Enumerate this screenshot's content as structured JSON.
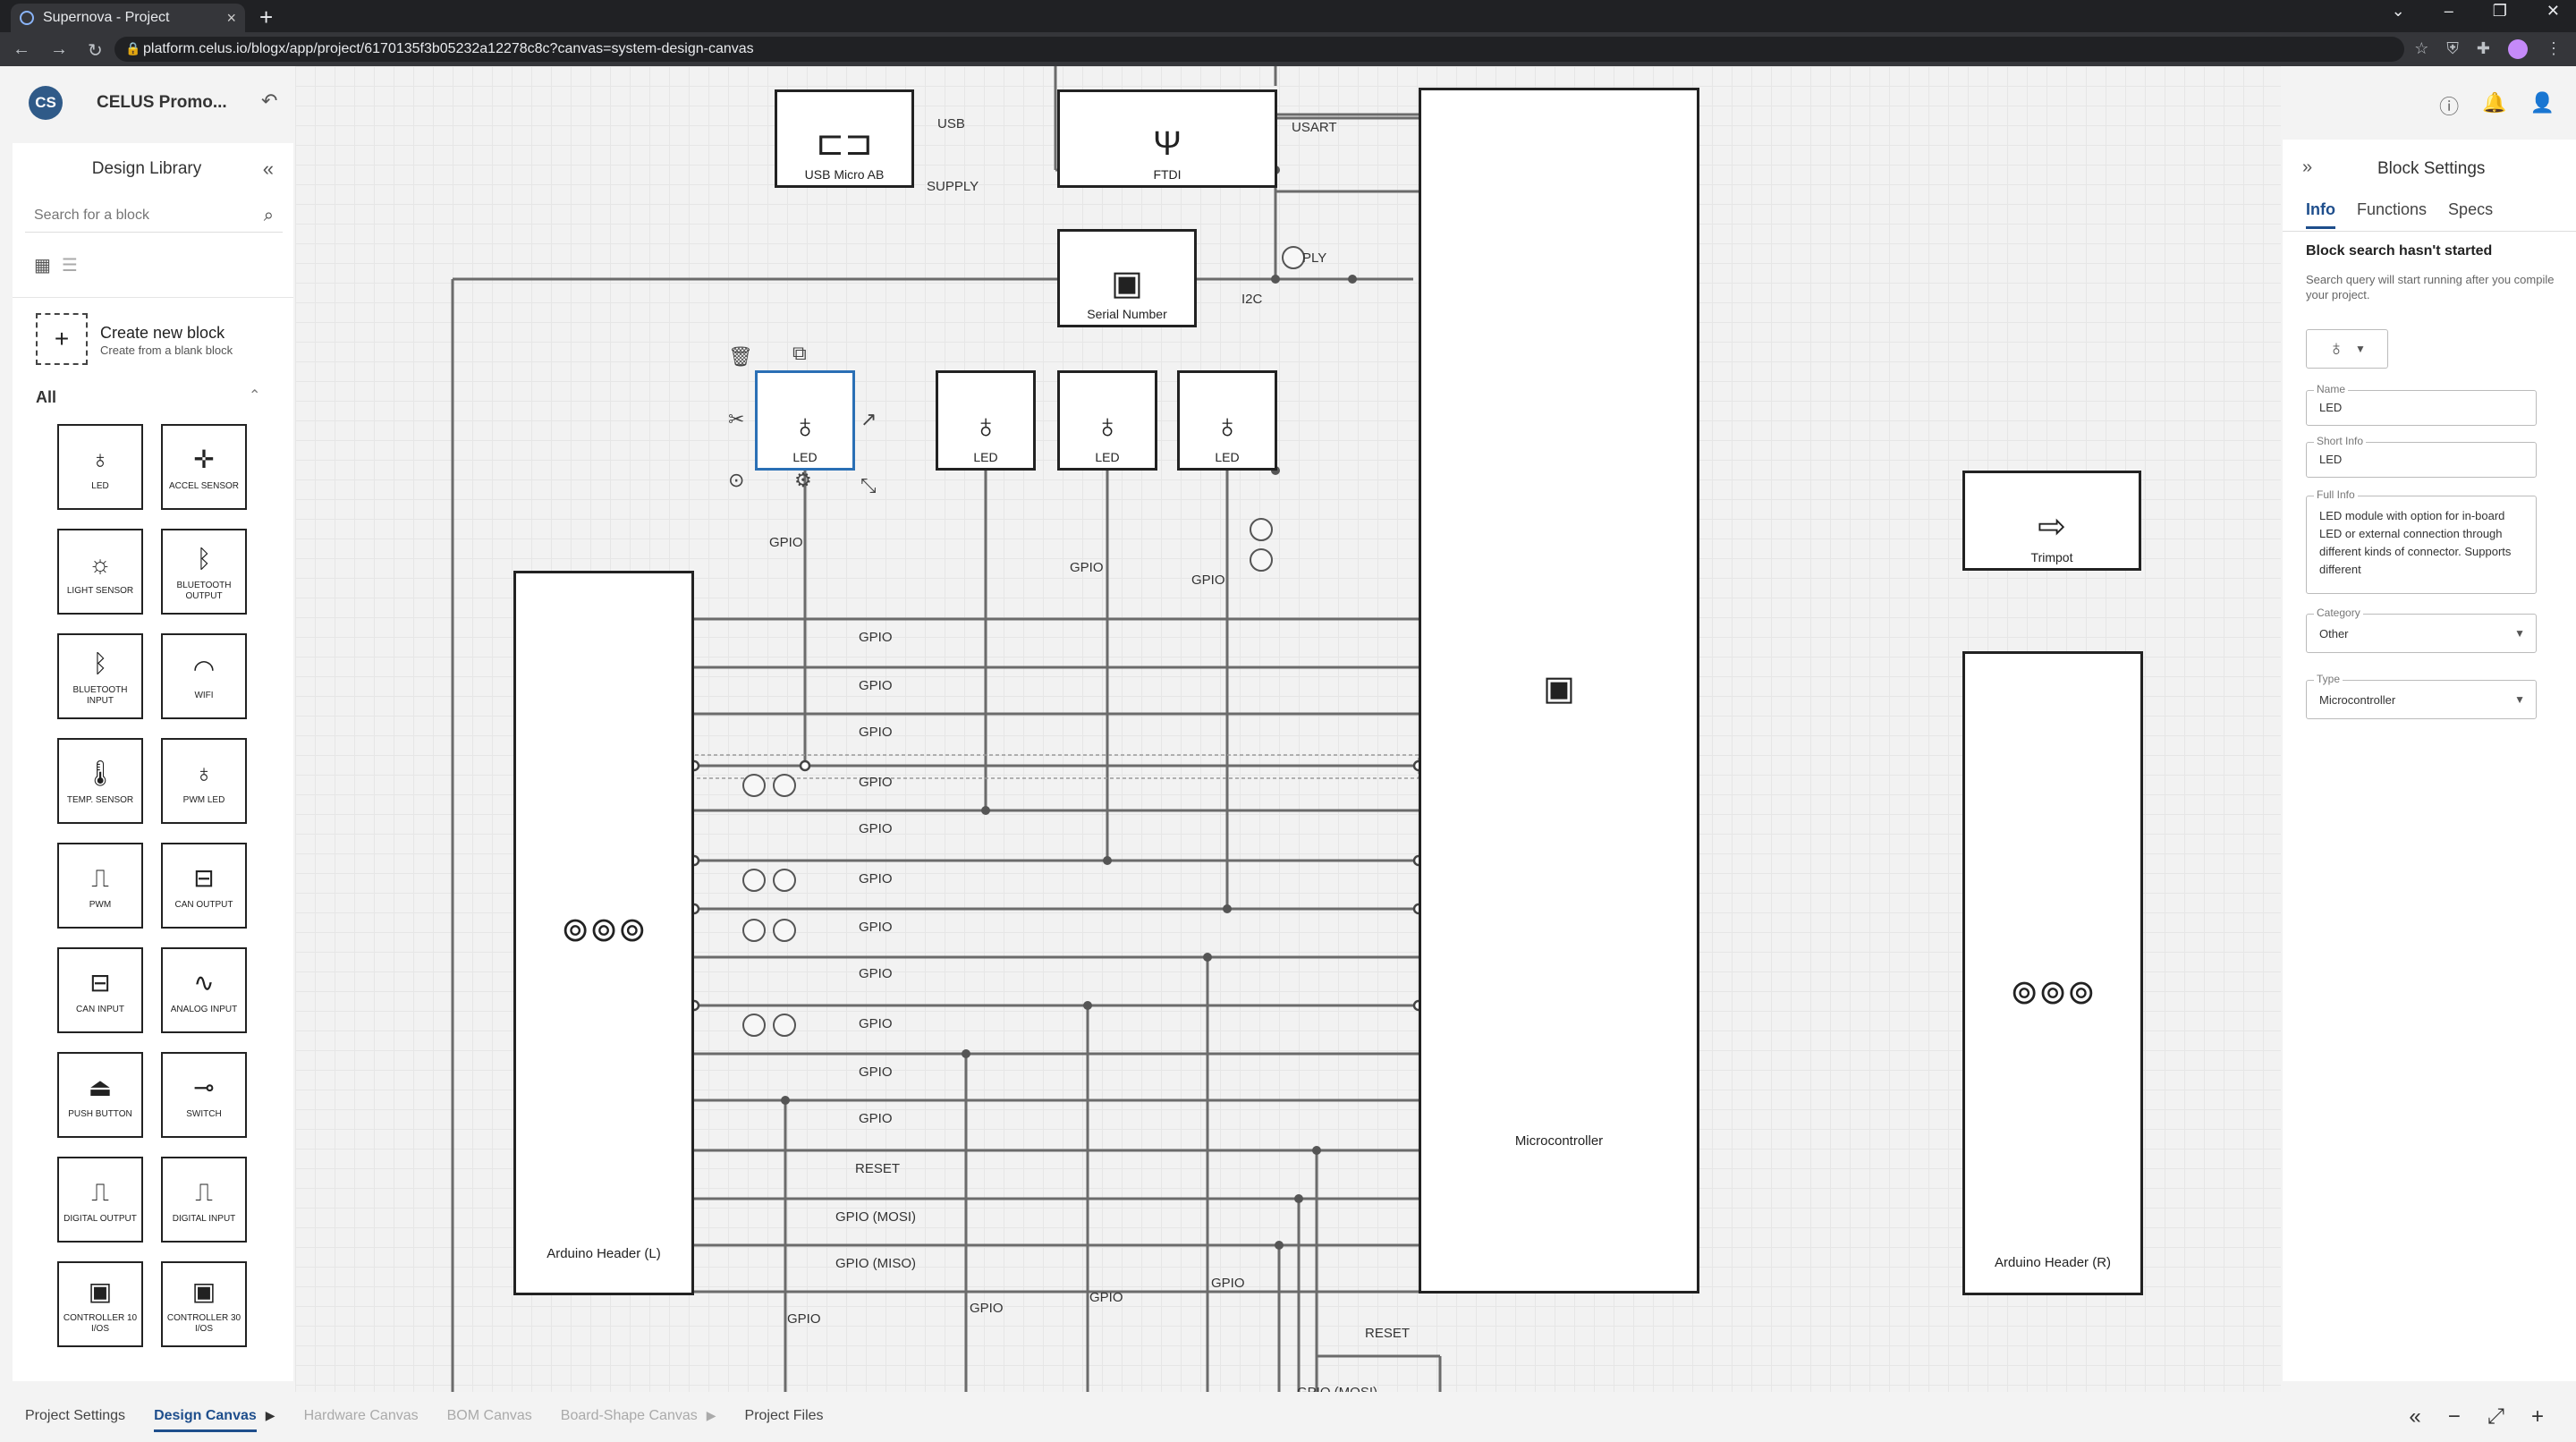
{
  "browser": {
    "tab_title": "Supernova - Project",
    "url": "platform.celus.io/blogx/app/project/6170135f3b05232a12278c8c?canvas=system-design-canvas"
  },
  "app": {
    "logo_text": "CS",
    "project_name": "CELUS Promo..."
  },
  "library": {
    "title": "Design Library",
    "search_placeholder": "Search for a block",
    "create_title": "Create new block",
    "create_sub": "Create from a blank block",
    "section": "All",
    "items": [
      {
        "label": "LED",
        "icon": "led-icon"
      },
      {
        "label": "ACCEL SENSOR",
        "icon": "accel-icon"
      },
      {
        "label": "LIGHT SENSOR",
        "icon": "light-sensor-icon"
      },
      {
        "label": "BLUETOOTH OUTPUT",
        "icon": "bluetooth-icon"
      },
      {
        "label": "BLUETOOTH INPUT",
        "icon": "bluetooth-icon"
      },
      {
        "label": "WIFI",
        "icon": "wifi-icon"
      },
      {
        "label": "TEMP. SENSOR",
        "icon": "thermometer-icon"
      },
      {
        "label": "PWM LED",
        "icon": "led-icon"
      },
      {
        "label": "PWM",
        "icon": "pwm-icon"
      },
      {
        "label": "CAN OUTPUT",
        "icon": "can-icon"
      },
      {
        "label": "CAN INPUT",
        "icon": "can-icon"
      },
      {
        "label": "ANALOG INPUT",
        "icon": "analog-icon"
      },
      {
        "label": "PUSH BUTTON",
        "icon": "push-button-icon"
      },
      {
        "label": "SWITCH",
        "icon": "switch-icon"
      },
      {
        "label": "DIGITAL OUTPUT",
        "icon": "digital-icon"
      },
      {
        "label": "DIGITAL INPUT",
        "icon": "digital-icon"
      },
      {
        "label": "CONTROLLER 10 I/OS",
        "icon": "chip-icon"
      },
      {
        "label": "CONTROLLER 30 I/OS",
        "icon": "chip-icon"
      }
    ]
  },
  "canvas": {
    "blocks": {
      "usb": "USB Micro AB",
      "ftdi": "FTDI",
      "serial": "Serial Number",
      "led1": "LED",
      "led2": "LED",
      "led3": "LED",
      "led4": "LED",
      "trimpot": "Trimpot",
      "mcu": "Microcontroller",
      "header_l": "Arduino Header (L)",
      "header_r": "Arduino Header (R)"
    },
    "wire_labels": {
      "usb": "USB",
      "supply": "SUPPLY",
      "usart": "USART",
      "ply": "PLY",
      "i2c": "I2C",
      "gpio": "GPIO",
      "reset": "RESET",
      "mosi": "GPIO (MOSI)",
      "miso": "GPIO (MISO)"
    }
  },
  "settings": {
    "title": "Block Settings",
    "tabs": [
      "Info",
      "Functions",
      "Specs"
    ],
    "status_title": "Block search hasn't started",
    "status_text": "Search query will start running after you compile your project.",
    "name_label": "Name",
    "name_value": "LED",
    "short_label": "Short Info",
    "short_value": "LED",
    "full_label": "Full Info",
    "full_value": "LED module with option for in-board LED or external connection through different kinds of connector. Supports different",
    "category_label": "Category",
    "category_value": "Other",
    "type_label": "Type",
    "type_value": "Microcontroller"
  },
  "bottom_tabs": {
    "project_settings": "Project Settings",
    "design_canvas": "Design Canvas",
    "hardware_canvas": "Hardware Canvas",
    "bom_canvas": "BOM Canvas",
    "board_shape_canvas": "Board-Shape Canvas",
    "project_files": "Project Files"
  }
}
